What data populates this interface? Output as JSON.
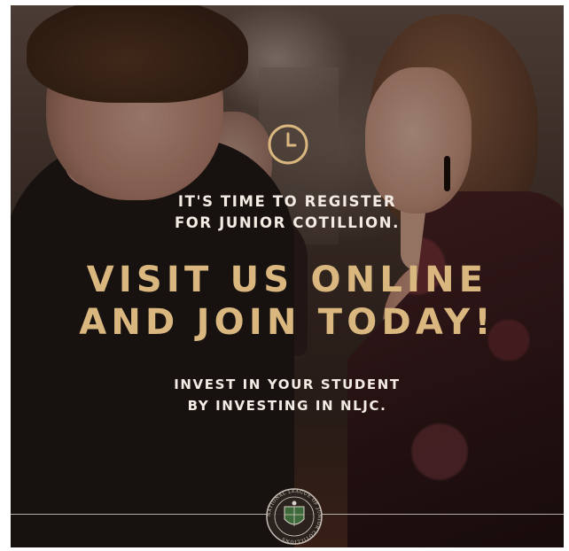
{
  "poster": {
    "subhead_lines": [
      "IT'S TIME TO REGISTER",
      "FOR JUNIOR COTILLION."
    ],
    "headline_lines": [
      "VISIT US ONLINE",
      "AND JOIN TODAY!"
    ],
    "tagline_lines": [
      "INVEST IN YOUR STUDENT",
      "BY INVESTING IN NLJC."
    ],
    "seal_text": "NATIONAL LEAGUE OF JUNIOR COTILLIONS",
    "icons": {
      "clock": "clock-icon",
      "seal": "nljc-seal-logo"
    },
    "colors": {
      "headline": "#d9b77e",
      "clock": "#d9b77e",
      "text": "#f4ece4",
      "overlay": "#120a08"
    }
  }
}
